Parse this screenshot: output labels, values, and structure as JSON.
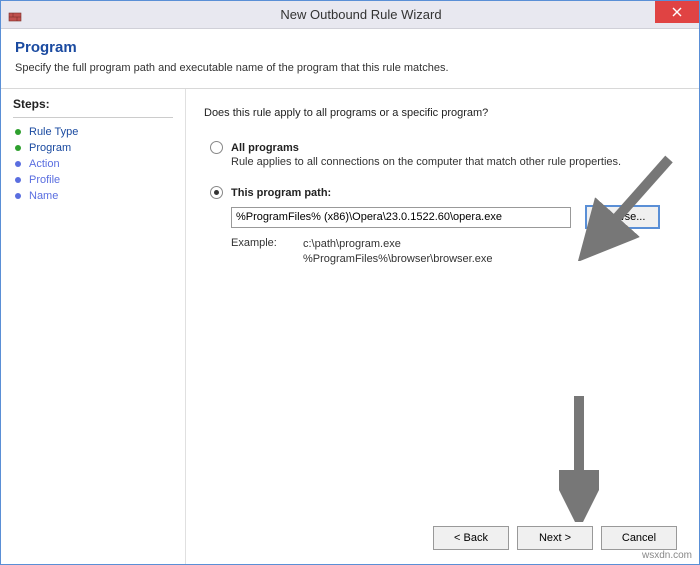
{
  "window": {
    "title": "New Outbound Rule Wizard"
  },
  "header": {
    "title": "Program",
    "subtitle": "Specify the full program path and executable name of the program that this rule matches."
  },
  "sidebar": {
    "heading": "Steps:",
    "items": [
      {
        "label": "Rule Type",
        "state": "done"
      },
      {
        "label": "Program",
        "state": "current"
      },
      {
        "label": "Action",
        "state": "pending"
      },
      {
        "label": "Profile",
        "state": "pending"
      },
      {
        "label": "Name",
        "state": "pending"
      }
    ]
  },
  "content": {
    "prompt": "Does this rule apply to all programs or a specific program?",
    "option_all": {
      "label": "All programs",
      "desc": "Rule applies to all connections on the computer that match other rule properties.",
      "selected": false
    },
    "option_path": {
      "label": "This program path:",
      "selected": true,
      "value": "%ProgramFiles% (x86)\\Opera\\23.0.1522.60\\opera.exe",
      "browse_label": "Browse..."
    },
    "example": {
      "label": "Example:",
      "line1": "c:\\path\\program.exe",
      "line2": "%ProgramFiles%\\browser\\browser.exe"
    }
  },
  "footer": {
    "back": "< Back",
    "next": "Next >",
    "cancel": "Cancel"
  },
  "watermark": "wsxdn.com"
}
